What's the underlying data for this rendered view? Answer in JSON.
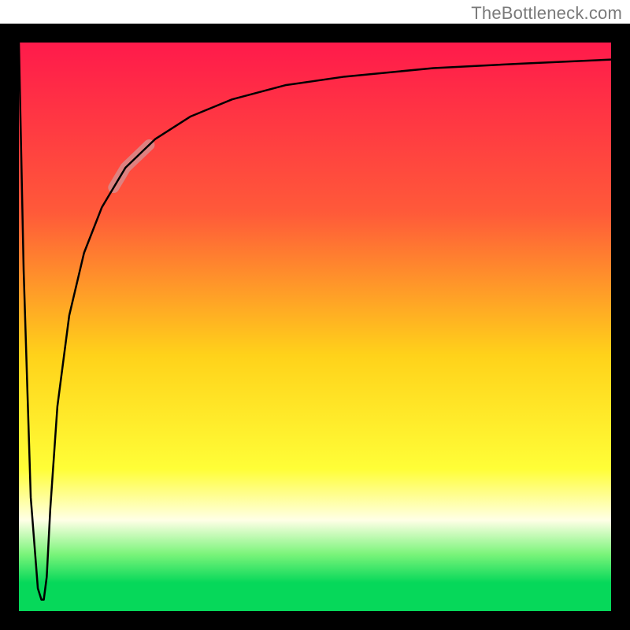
{
  "attribution": "TheBottleneck.com",
  "chart_data": {
    "type": "line",
    "title": "",
    "xlabel": "",
    "ylabel": "",
    "xlim": [
      0,
      100
    ],
    "ylim": [
      0,
      100
    ],
    "gradient": {
      "stops": [
        {
          "offset": 0.0,
          "color": "#ff1a4b"
        },
        {
          "offset": 0.3,
          "color": "#ff5a39"
        },
        {
          "offset": 0.55,
          "color": "#ffd21a"
        },
        {
          "offset": 0.75,
          "color": "#fffe37"
        },
        {
          "offset": 0.84,
          "color": "#ffffe6"
        },
        {
          "offset": 0.9,
          "color": "#7af47a"
        },
        {
          "offset": 0.95,
          "color": "#06d85a"
        },
        {
          "offset": 1.0,
          "color": "#06d85a"
        }
      ]
    },
    "series": [
      {
        "name": "bottleneck-curve",
        "x": [
          0,
          0.8,
          2.0,
          3.2,
          3.8,
          4.2,
          4.7,
          5.3,
          6.5,
          8.5,
          11,
          14,
          18,
          23,
          29,
          36,
          45,
          55,
          70,
          85,
          100
        ],
        "y": [
          100,
          60,
          20,
          4,
          2,
          2,
          6,
          18,
          36,
          52,
          63,
          71,
          78,
          83,
          87,
          90,
          92.5,
          94,
          95.5,
          96.3,
          97
        ]
      }
    ],
    "highlight_segment": {
      "series": "bottleneck-curve",
      "x_start": 16,
      "x_end": 22,
      "color": "#d88c8c",
      "width": 14
    },
    "frame": {
      "color": "#000000",
      "thickness": 24
    }
  }
}
